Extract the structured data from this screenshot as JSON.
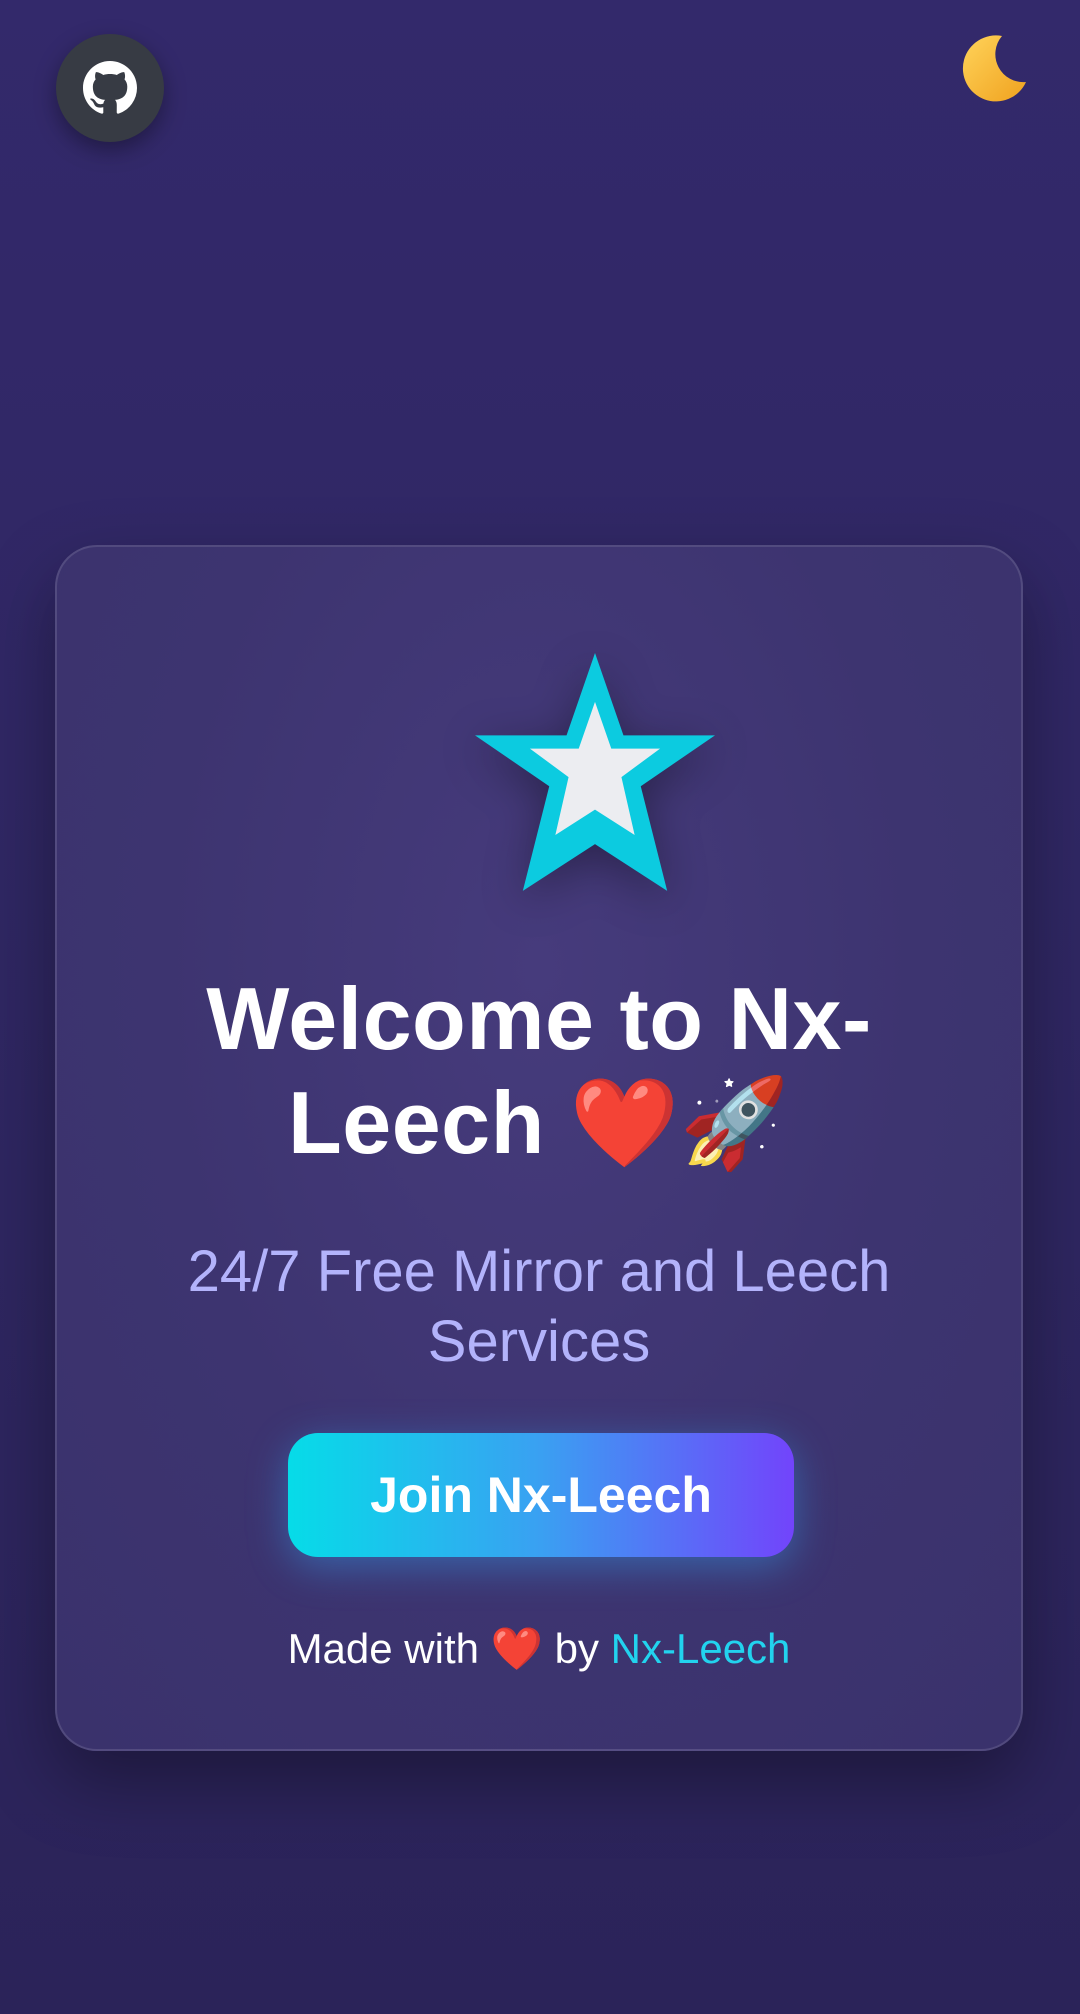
{
  "header": {
    "github_icon": "github-icon",
    "theme_toggle_icon": "moon-icon"
  },
  "card": {
    "logo_icon": "star-icon",
    "title": "Welcome to Nx-Leech ❤️🚀",
    "subtitle": "24/7 Free Mirror and Leech Services",
    "join_button_label": "Join Nx-Leech",
    "footer": {
      "made_with": "Made with",
      "heart": "❤️",
      "by": "by",
      "link_text": "Nx-Leech"
    }
  },
  "colors": {
    "background": "#33296b",
    "card": "#3e3572",
    "accent_cyan": "#06dce8",
    "accent_purple": "#7244fb",
    "subtitle": "#b3b3fb",
    "link": "#22d3ee",
    "moon": "#f5b72e"
  }
}
